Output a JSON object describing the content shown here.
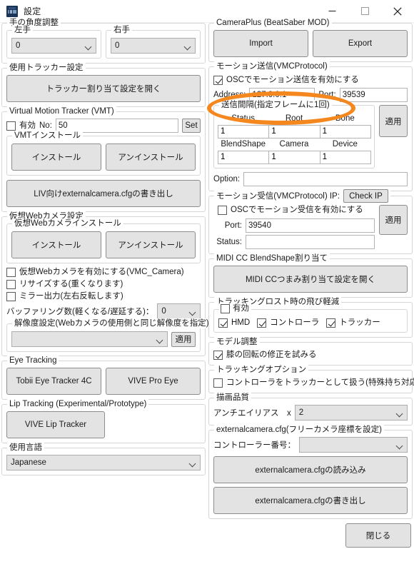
{
  "window": {
    "title": "設定",
    "icon": "app-icon",
    "minimize_label": "minimize",
    "maximize_label": "maximize",
    "close_label": "close"
  },
  "left": {
    "hand_angle": {
      "title": "手の角度調整",
      "left_hand": {
        "title": "左手",
        "value": "0"
      },
      "right_hand": {
        "title": "右手",
        "value": "0"
      }
    },
    "tracker_settings": {
      "title": "使用トラッカー設定",
      "open_button": "トラッカー割り当て設定を開く"
    },
    "vmt": {
      "title": "Virtual Motion Tracker (VMT)",
      "enable_label": "有効",
      "enable_checked": false,
      "no_label": "No:",
      "no_value": "50",
      "set_button": "Set",
      "install_group": "VMTインストール",
      "install_button": "インストール",
      "uninstall_button": "アンインストール",
      "liv_export_button": "LIV向けexternalcamera.cfgの書き出し"
    },
    "webcam": {
      "title": "仮想Webカメラ設定",
      "install_group": "仮想Webカメラインストール",
      "install_button": "インストール",
      "uninstall_button": "アンインストール",
      "enable_label": "仮想Webカメラを有効にする(VMC_Camera)",
      "enable_checked": false,
      "resize_label": "リサイズする(重くなります)",
      "resize_checked": false,
      "mirror_label": "ミラー出力(左右反転します)",
      "mirror_checked": false,
      "buffer_label": "バッファリング数(軽くなる/遅延する)：",
      "buffer_value": "0",
      "resolution_group": "解像度設定(Webカメラの使用側と同じ解像度を指定)",
      "resolution_value": "",
      "apply_button": "適用"
    },
    "eye_tracking": {
      "title": "Eye Tracking",
      "tobii_button": "Tobii Eye Tracker 4C",
      "vive_button": "VIVE Pro Eye"
    },
    "lip_tracking": {
      "title": "Lip Tracking (Experimental/Prototype)",
      "vive_lip_button": "VIVE Lip Tracker"
    },
    "language": {
      "title": "使用言語",
      "value": "Japanese"
    }
  },
  "right": {
    "cameraplus": {
      "title": "CameraPlus (BeatSaber MOD)",
      "import_button": "Import",
      "export_button": "Export"
    },
    "motion_send": {
      "title": "モーション送信(VMCProtocol)",
      "enable_label": "OSCでモーション送信を有効にする",
      "enable_checked": true,
      "address_label": "Address:",
      "address_value": "127.0.0.1",
      "port_label": "Port:",
      "port_value": "39539",
      "interval_group": "送信間隔(指定フレームに1回)",
      "interval_headers_row1": [
        "Status",
        "Root",
        "Bone"
      ],
      "interval_values_row1": [
        "1",
        "1",
        "1"
      ],
      "interval_headers_row2": [
        "BlendShape",
        "Camera",
        "Device"
      ],
      "interval_values_row2": [
        "1",
        "1",
        "1"
      ],
      "apply_button": "適用",
      "option_label": "Option:",
      "option_value": ""
    },
    "motion_receive": {
      "title": "モーション受信(VMCProtocol) IP:",
      "check_ip_button": "Check IP",
      "enable_label": "OSCでモーション受信を有効にする",
      "enable_checked": false,
      "port_label": "Port:",
      "port_value": "39540",
      "status_label": "Status:",
      "status_value": "",
      "apply_button": "適用"
    },
    "midi": {
      "title": "MIDI CC BlendShape割り当て",
      "open_button": "MIDI CCつまみ割り当て設定を開く"
    },
    "tracking_lost": {
      "title": "トラッキングロスト時の飛び軽減",
      "enable_label": "有効",
      "enable_checked": true,
      "hmd_label": "HMD",
      "hmd_checked": true,
      "controller_label": "コントローラ",
      "controller_checked": true,
      "tracker_label": "トラッカー",
      "tracker_checked": true
    },
    "model_adjust": {
      "title": "モデル調整",
      "knee_label": "膝の回転の修正を試みる",
      "knee_checked": true
    },
    "tracking_option": {
      "title": "トラッキングオプション",
      "controller_as_tracker_label": "コントローラをトラッカーとして扱う(特殊持ち対応)",
      "controller_as_tracker_checked": false
    },
    "quality": {
      "title": "描画品質",
      "aa_label": "アンチエイリアス　x",
      "aa_value": "2"
    },
    "externalcamera": {
      "title": "externalcamera.cfg(フリーカメラ座標を設定)",
      "controller_number_label": "コントローラー番号：",
      "controller_number_value": "",
      "load_button": "externalcamera.cfgの読み込み",
      "save_button": "externalcamera.cfgの書き出し"
    },
    "close_button": "閉じる"
  },
  "annotation": {
    "shape": "ellipse",
    "color": "#f5871f",
    "targets": [
      "モーション送信(VMCProtocol)",
      "OSCでモーション送信を有効にする"
    ]
  }
}
